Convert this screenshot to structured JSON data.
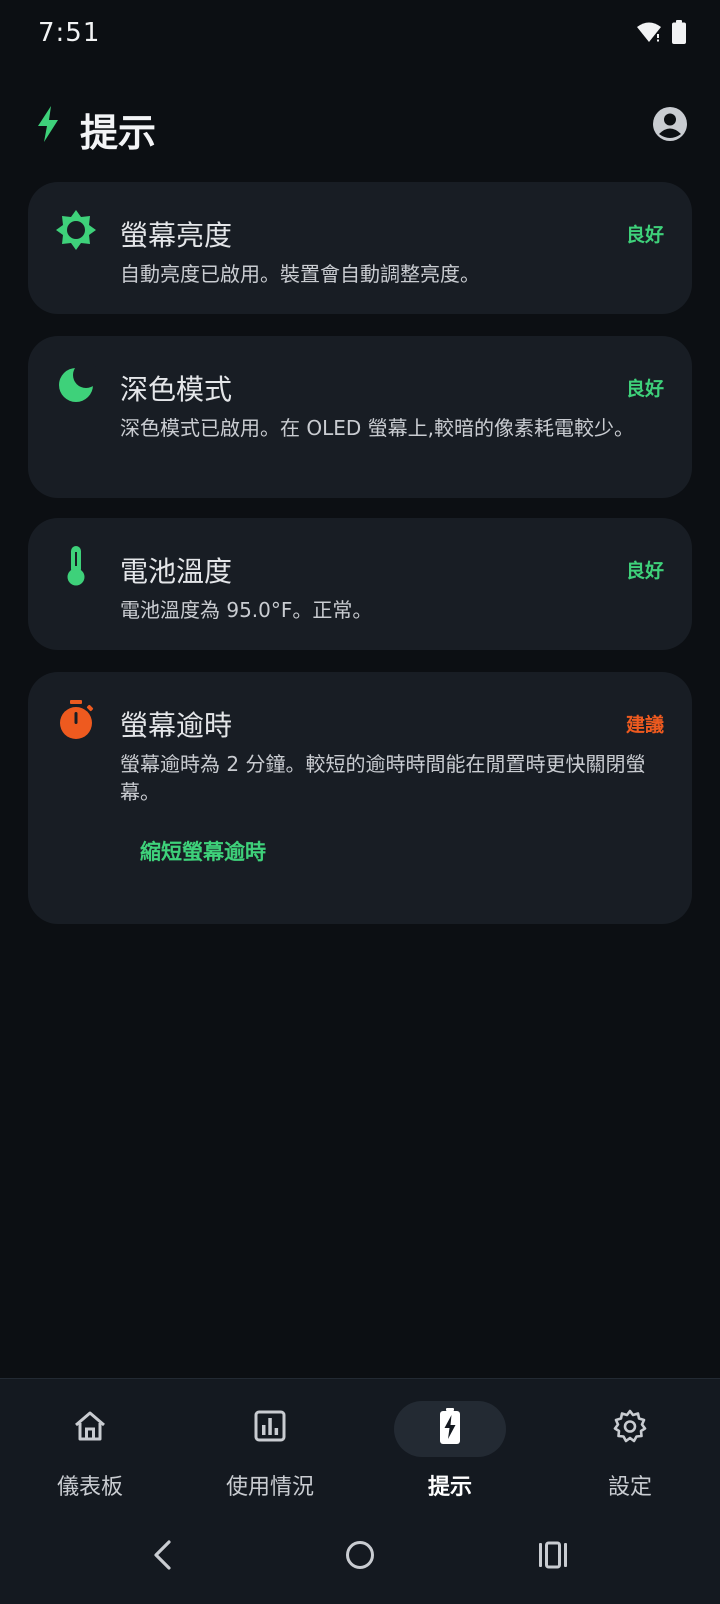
{
  "status_bar": {
    "time": "7:51"
  },
  "header": {
    "title": "提示"
  },
  "tips": [
    {
      "icon": "brightness-icon",
      "title": "螢幕亮度",
      "status": "良好",
      "status_type": "good",
      "description": "自動亮度已啟用。裝置會自動調整亮度。"
    },
    {
      "icon": "moon-icon",
      "title": "深色模式",
      "status": "良好",
      "status_type": "good",
      "description": "深色模式已啟用。在 OLED 螢幕上,較暗的像素耗電較少。"
    },
    {
      "icon": "thermometer-icon",
      "title": "電池溫度",
      "status": "良好",
      "status_type": "good",
      "description": "電池溫度為 95.0°F。正常。"
    },
    {
      "icon": "timer-icon",
      "title": "螢幕逾時",
      "status": "建議",
      "status_type": "warn",
      "description": "螢幕逾時為 2 分鐘。較短的逾時時間能在閒置時更快關閉螢幕。",
      "action_label": "縮短螢幕逾時"
    }
  ],
  "bottom_nav": [
    {
      "label": "儀表板",
      "icon": "home-icon",
      "active": false
    },
    {
      "label": "使用情況",
      "icon": "chart-icon",
      "active": false
    },
    {
      "label": "提示",
      "icon": "battery-bolt-icon",
      "active": true
    },
    {
      "label": "設定",
      "icon": "gear-icon",
      "active": false
    }
  ],
  "colors": {
    "accent": "#3ed17a",
    "warning": "#ee5a1f",
    "card": "#181d24",
    "background": "#0c0f13"
  }
}
